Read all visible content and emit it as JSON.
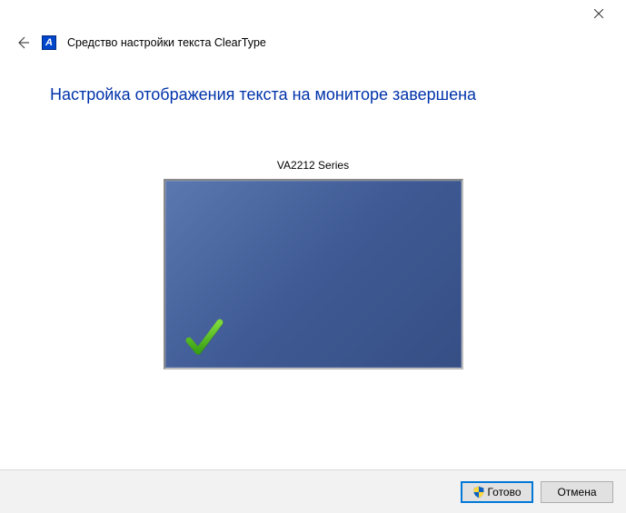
{
  "window": {
    "title": "Средство настройки текста ClearType",
    "app_icon_letter": "A"
  },
  "content": {
    "heading": "Настройка отображения текста на мониторе завершена",
    "monitor_name": "VA2212 Series"
  },
  "buttons": {
    "finish": "Готово",
    "cancel": "Отмена"
  }
}
